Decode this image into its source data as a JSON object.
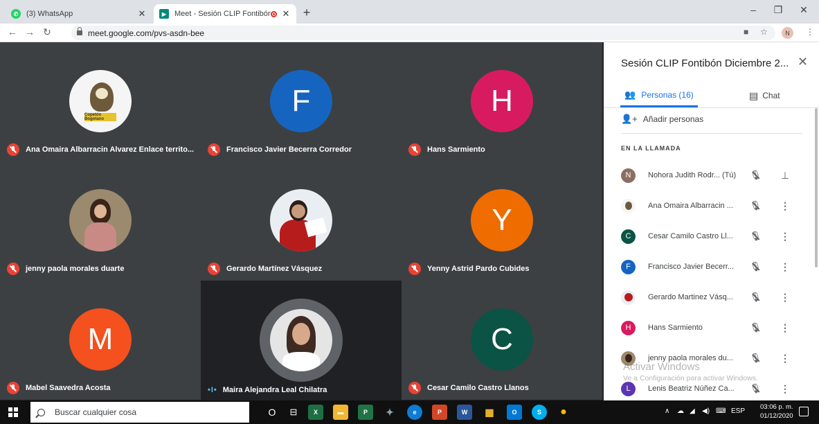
{
  "browser": {
    "tabs": [
      {
        "label": "(3) WhatsApp",
        "active": false,
        "favicon": "whatsapp-icon",
        "color": "#25d366"
      },
      {
        "label": "Meet - Sesión CLIP Fontibón",
        "active": true,
        "favicon": "google-meet-icon",
        "color": "#00897b"
      }
    ],
    "new_tab": "+",
    "url": "meet.google.com/pvs-asdn-bee",
    "profile_initial": "N",
    "window_controls": [
      "–",
      "❐",
      "✕"
    ]
  },
  "grid": {
    "tiles": [
      {
        "name": "Ana Omaira Albarracin Alvarez Enlace territo...",
        "avatar": "photo-bird",
        "muted": true
      },
      {
        "name": "Francisco Javier Becerra Corredor",
        "avatar": "F",
        "color": "#1565c0",
        "muted": true
      },
      {
        "name": "Hans Sarmiento",
        "avatar": "H",
        "color": "#d81b60",
        "muted": true
      },
      {
        "name": "jenny paola morales duarte",
        "avatar": "photo-jenny",
        "muted": true
      },
      {
        "name": "Gerardo Martínez Vásquez",
        "avatar": "photo-gerardo",
        "muted": true
      },
      {
        "name": "Yenny Astrid Pardo Cubides",
        "avatar": "Y",
        "color": "#ef6c00",
        "muted": true
      },
      {
        "name": "Mabel Saavedra Acosta",
        "avatar": "M",
        "color": "#f4511e",
        "muted": true
      },
      {
        "name": "Maira Alejandra Leal Chilatra",
        "avatar": "photo-maira",
        "muted": false,
        "speaking": true
      },
      {
        "name": "Cesar Camilo Castro Llanos",
        "avatar": "C",
        "color": "#0b5345",
        "muted": true
      }
    ]
  },
  "panel": {
    "title": "Sesión CLIP Fontibón Diciembre 2...",
    "tab_people": "Personas (16)",
    "tab_chat": "Chat",
    "add_people": "Añadir personas",
    "section": "EN LA LLAMADA",
    "people": [
      {
        "name": "Nohora Judith Rodr... (Tú)",
        "initial": "N",
        "color": "#8d6e63",
        "action": "pin"
      },
      {
        "name": "Ana Omaira Albarracin ...",
        "initial": "",
        "color": "#f5f5f5",
        "action": "more"
      },
      {
        "name": "Cesar Camilo Castro Ll...",
        "initial": "C",
        "color": "#0b5345",
        "action": "more"
      },
      {
        "name": "Francisco Javier Becerr...",
        "initial": "F",
        "color": "#1565c0",
        "action": "more"
      },
      {
        "name": "Gerardo Martinez Vásq...",
        "initial": "",
        "color": "#e9eef3",
        "action": "more"
      },
      {
        "name": "Hans Sarmiento",
        "initial": "H",
        "color": "#d81b60",
        "action": "more"
      },
      {
        "name": "jenny paola morales du...",
        "initial": "",
        "color": "#9c8a6e",
        "action": "more"
      },
      {
        "name": "Lenis Beatriz Núñez Ca...",
        "initial": "L",
        "color": "#5e35b1",
        "action": "more"
      }
    ]
  },
  "watermark": {
    "line1": "Activar Windows",
    "line2": "Ve a Configuración para activar Windows."
  },
  "taskbar": {
    "search_placeholder": "Buscar cualquier cosa",
    "apps": [
      {
        "label": "O",
        "icon": "cortana-icon",
        "color": "#101010"
      },
      {
        "label": "⊟",
        "icon": "task-view-icon",
        "color": "#101010"
      },
      {
        "label": "X",
        "icon": "excel-icon",
        "color": "#1d6f42"
      },
      {
        "label": "▬",
        "icon": "file-explorer-icon",
        "color": "#f2b632"
      },
      {
        "label": "P",
        "icon": "project-icon",
        "color": "#217346"
      },
      {
        "label": "✦",
        "icon": "app-icon",
        "color": "#101010"
      },
      {
        "label": "e",
        "icon": "edge-icon",
        "color": "#0f7bd3"
      },
      {
        "label": "P",
        "icon": "powerpoint-icon",
        "color": "#d24726"
      },
      {
        "label": "W",
        "icon": "word-icon",
        "color": "#2b579a"
      },
      {
        "label": "▦",
        "icon": "store-icon",
        "color": "#101010"
      },
      {
        "label": "O",
        "icon": "outlook-icon",
        "color": "#0078d4"
      },
      {
        "label": "S",
        "icon": "skype-icon",
        "color": "#00aff0"
      },
      {
        "label": "●",
        "icon": "chrome-icon",
        "color": "#101010"
      }
    ],
    "lang": "ESP",
    "time": "03:06 p. m.",
    "date": "01/12/2020"
  }
}
